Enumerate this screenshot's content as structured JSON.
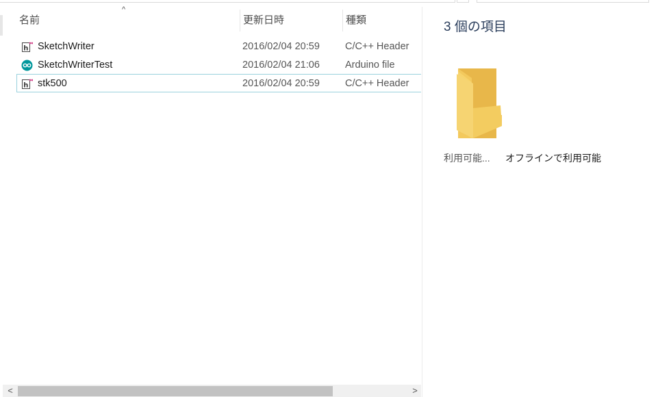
{
  "columns": {
    "name": "名前",
    "date": "更新日時",
    "type": "種類"
  },
  "sort_indicator": "^",
  "files": [
    {
      "name": "SketchWriter",
      "date": "2016/02/04 20:59",
      "type": "C/C++ Header",
      "icon": "header-file-icon"
    },
    {
      "name": "SketchWriterTest",
      "date": "2016/02/04 21:06",
      "type": "Arduino file",
      "icon": "arduino-file-icon"
    },
    {
      "name": "stk500",
      "date": "2016/02/04 20:59",
      "type": "C/C++ Header",
      "icon": "header-file-icon"
    }
  ],
  "preview": {
    "item_count": "3 個の項目",
    "availability_label": "利用可能...",
    "availability_value": "オフラインで利用可能"
  },
  "scrollbar": {
    "left_arrow": "<",
    "right_arrow": ">"
  },
  "colors": {
    "selection_border": "#99d1dd",
    "arduino_teal": "#00979c",
    "folder_yellow": "#f7d36b",
    "header_icon_pink": "#d1478c"
  }
}
